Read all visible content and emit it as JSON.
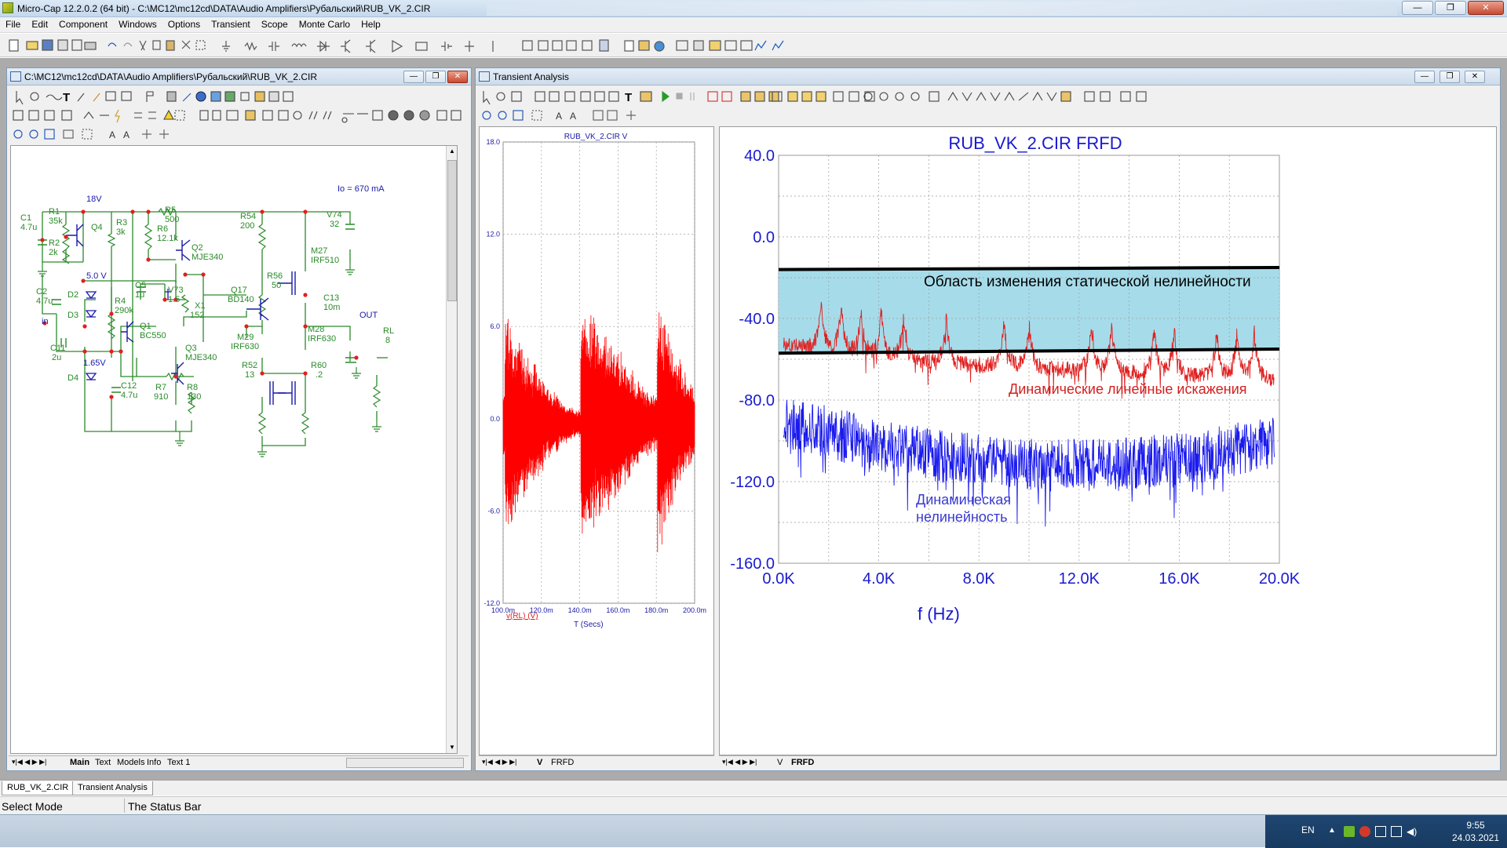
{
  "app": {
    "title": "Micro-Cap 12.2.0.2 (64 bit) - C:\\MC12\\mc12cd\\DATA\\Audio Amplifiers\\Рубальский\\RUB_VK_2.CIR",
    "window_controls": [
      "—",
      "❐",
      "✕"
    ]
  },
  "menu": [
    "File",
    "Edit",
    "Component",
    "Windows",
    "Options",
    "Transient",
    "Scope",
    "Monte Carlo",
    "Help"
  ],
  "schematic_window": {
    "title": "C:\\MC12\\mc12cd\\DATA\\Audio Amplifiers\\Рубальский\\RUB_VK_2.CIR",
    "tabs": [
      "Main",
      "Text",
      "Models",
      "Info",
      "Text 1"
    ],
    "active_tab": "Main",
    "annotation": "Io = 670 mA",
    "components": [
      {
        "ref": "C1",
        "value": "4.7u"
      },
      {
        "ref": "R1",
        "value": "35k"
      },
      {
        "ref": "R2",
        "value": "2k"
      },
      {
        "ref": "Q4",
        "value": ""
      },
      {
        "ref": "R3",
        "value": "3k"
      },
      {
        "ref": "R5",
        "value": "500"
      },
      {
        "ref": "R6",
        "value": "12.1k"
      },
      {
        "ref": "Q2",
        "value": "MJE340"
      },
      {
        "ref": "R54",
        "value": "200"
      },
      {
        "ref": "V74",
        "value": "32"
      },
      {
        "ref": "M27",
        "value": "IRF510"
      },
      {
        "ref": "C2",
        "value": "4.7u"
      },
      {
        "ref": "D2",
        "value": ""
      },
      {
        "ref": "D3",
        "value": ""
      },
      {
        "ref": "R4",
        "value": "290k"
      },
      {
        "ref": "C5",
        "value": "1u"
      },
      {
        "ref": "V73",
        "value": "1.5"
      },
      {
        "ref": "X1",
        "value": "152"
      },
      {
        "ref": "R56",
        "value": "50"
      },
      {
        "ref": "Q17",
        "value": "BD140"
      },
      {
        "ref": "C13",
        "value": "10m"
      },
      {
        "ref": "Q1",
        "value": "BC550"
      },
      {
        "ref": "C11",
        "value": "2u"
      },
      {
        "ref": "Q3",
        "value": "MJE340"
      },
      {
        "ref": "M29",
        "value": "IRF630"
      },
      {
        "ref": "M28",
        "value": "IRF630"
      },
      {
        "ref": "RL",
        "value": "8"
      },
      {
        "ref": "D4",
        "value": ""
      },
      {
        "ref": "C12",
        "value": "4.7u"
      },
      {
        "ref": "R7",
        "value": "910"
      },
      {
        "ref": "R8",
        "value": "130"
      },
      {
        "ref": "R52",
        "value": "13"
      },
      {
        "ref": "R60",
        "value": ".2"
      }
    ],
    "node_labels": {
      "v18": "18V",
      "v5": "5.0 V",
      "v165": "1.65V",
      "in": "in",
      "out": "OUT"
    }
  },
  "transient_window": {
    "title": "Transient Analysis",
    "tabs": [
      "V",
      "FRFD"
    ],
    "active_tab_left": "V",
    "active_tab_right": "FRFD"
  },
  "chart_data": [
    {
      "type": "line",
      "title": "RUB_VK_2.CIR V",
      "xlabel": "T (Secs)",
      "ylabel": "",
      "series": [
        {
          "name": "v(RL) (V)",
          "color": "#ff0000"
        }
      ],
      "x_ticks": [
        "100.0m",
        "120.0m",
        "140.0m",
        "160.0m",
        "180.0m",
        "200.0m"
      ],
      "y_ticks": [
        "18.0",
        "12.0",
        "6.0",
        "0.0",
        "-6.0",
        "-12.0"
      ],
      "xlim": [
        0.1,
        0.2
      ],
      "ylim": [
        -12,
        18
      ],
      "grid": true,
      "envelope": [
        {
          "t": 0.101,
          "amp": 8.2
        },
        {
          "t": 0.12,
          "amp": 3.5
        },
        {
          "t": 0.138,
          "amp": 1.0
        },
        {
          "t": 0.1405,
          "amp": 8.5
        },
        {
          "t": 0.16,
          "amp": 5.5
        },
        {
          "t": 0.178,
          "amp": 2.0
        },
        {
          "t": 0.1805,
          "amp": 9.8
        },
        {
          "t": 0.2,
          "amp": 2.5
        }
      ]
    },
    {
      "type": "line",
      "title": "RUB_VK_2.CIR FRFD",
      "xlabel": "f (Hz)",
      "ylabel": "",
      "x_ticks": [
        "0.0K",
        "4.0K",
        "8.0K",
        "12.0K",
        "16.0K",
        "20.0K"
      ],
      "y_ticks": [
        "40.0",
        "0.0",
        "-40.0",
        "-80.0",
        "-120.0",
        "-160.0"
      ],
      "xlim": [
        0,
        20000
      ],
      "ylim": [
        -160,
        40
      ],
      "grid": true,
      "series": [
        {
          "name": "Динамические линейные искажения",
          "color": "#e02020",
          "baseline": [
            -52,
            -58,
            -62,
            -64,
            -66,
            -68,
            -70
          ],
          "peaks_khz": [
            1.7,
            2.5,
            3.3,
            4.1,
            5.0,
            6.7,
            9.0,
            10.0,
            12.5,
            13.3,
            15.0,
            15.8,
            17.5,
            18.3,
            19.0
          ]
        },
        {
          "name": "Динамическая нелинейность",
          "color": "#1a1aee",
          "baseline": [
            -90,
            -100,
            -108,
            -112,
            -112,
            -108,
            -100
          ]
        }
      ],
      "annotations": [
        {
          "text": "Область изменения статической нелинейности",
          "color": "#000000"
        },
        {
          "text": "Динамические линейные искажения",
          "color": "#d32020"
        },
        {
          "text": "Динамическая",
          "color": "#3a3ad0"
        },
        {
          "text": "нелинейность",
          "color": "#3a3ad0"
        }
      ],
      "band": {
        "upper_start": -16,
        "upper_end": -15,
        "lower_start": -57,
        "lower_end": -55,
        "fill": "#a6dcea"
      }
    }
  ],
  "bottom_tabs": [
    "RUB_VK_2.CIR",
    "Transient Analysis"
  ],
  "status": {
    "mode": "Select Mode",
    "message": "The Status Bar"
  },
  "tray": {
    "lang": "EN",
    "time": "9:55",
    "date": "24.03.2021"
  },
  "colors": {
    "schematic_wire": "#2a8a2a",
    "schematic_label": "#2a8a2a",
    "device": "#1a1aa8",
    "annotation": "#1a1aa8",
    "trace_red": "#ff0000",
    "trace_blue": "#1a1aee",
    "axis_text": "#1a1ad0"
  }
}
